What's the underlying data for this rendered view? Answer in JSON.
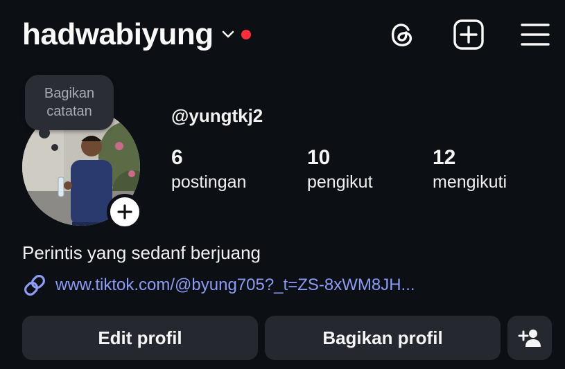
{
  "header": {
    "username": "hadwabiyung",
    "icons": [
      "threads-icon",
      "create-post-icon",
      "menu-icon"
    ],
    "notification_dot_color": "#ff2d3c"
  },
  "note": {
    "line1": "Bagikan",
    "line2": "catatan"
  },
  "profile": {
    "handle": "@yungtkj2",
    "bio": "Perintis yang sedanf berjuang",
    "link": "www.tiktok.com/@byung705?_t=ZS-8xWM8JH..."
  },
  "stats": {
    "posts": {
      "value": "6",
      "label": "postingan"
    },
    "followers": {
      "value": "10",
      "label": "pengikut"
    },
    "following": {
      "value": "12",
      "label": "mengikuti"
    }
  },
  "actions": {
    "edit_label": "Edit profil",
    "share_label": "Bagikan profil"
  },
  "colors": {
    "background": "#0c0f14",
    "button_bg": "#25282e",
    "link": "#8c9bf5"
  }
}
